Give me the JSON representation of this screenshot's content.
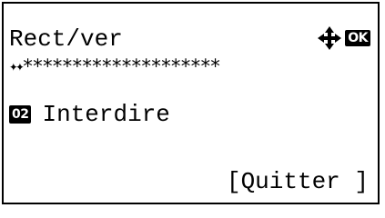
{
  "screen": {
    "title": "Rect/ver",
    "nav_icon": "four-way-arrow-icon",
    "ok_label": "OK"
  },
  "progress": {
    "done_text": "✦✦",
    "remaining_text": "********************"
  },
  "item": {
    "number": "02",
    "label": "Interdire"
  },
  "softkey": {
    "open_bracket": "[",
    "label": "Quitter",
    "close_bracket": " ]"
  },
  "colors": {
    "foreground": "#000000",
    "background": "#ffffff"
  }
}
